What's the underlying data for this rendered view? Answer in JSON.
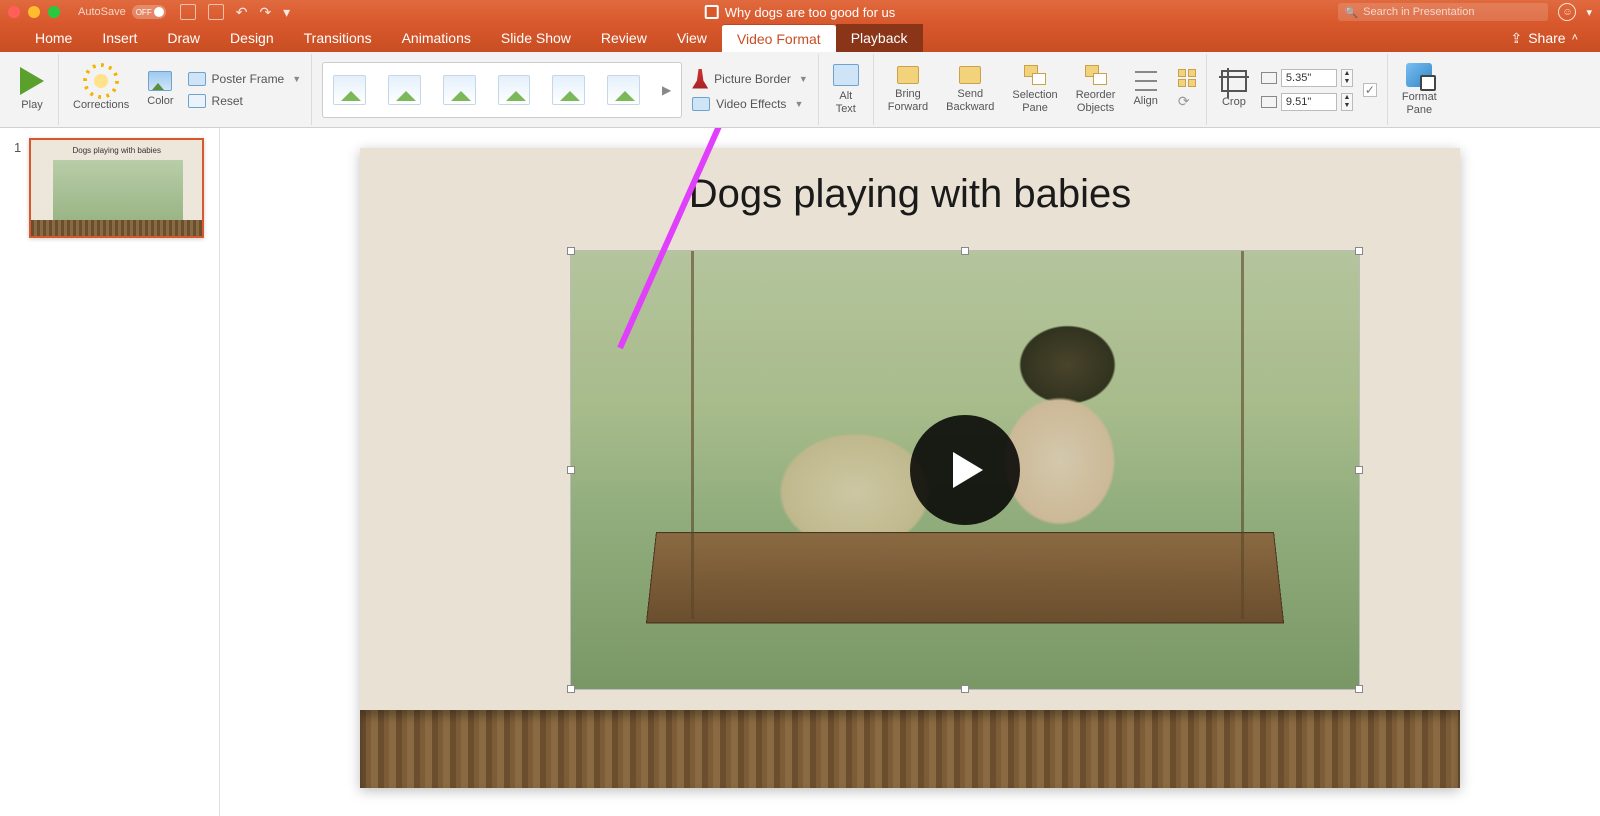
{
  "titlebar": {
    "autosave_label": "AutoSave",
    "autosave_state": "OFF",
    "doc_title": "Why dogs are too good for us",
    "search_placeholder": "Search in Presentation"
  },
  "tabs": {
    "items": [
      "Home",
      "Insert",
      "Draw",
      "Design",
      "Transitions",
      "Animations",
      "Slide Show",
      "Review",
      "View"
    ],
    "active": "Video Format",
    "context_extra": "Playback",
    "share": "Share"
  },
  "ribbon": {
    "play": "Play",
    "corrections": "Corrections",
    "color": "Color",
    "poster_frame": "Poster Frame",
    "reset": "Reset",
    "picture_border": "Picture Border",
    "video_effects": "Video Effects",
    "alt_text": "Alt\nText",
    "bring_forward": "Bring\nForward",
    "send_backward": "Send\nBackward",
    "selection_pane": "Selection\nPane",
    "reorder_objects": "Reorder\nObjects",
    "align": "Align",
    "crop": "Crop",
    "height_value": "5.35\"",
    "width_value": "9.51\"",
    "format_pane": "Format\nPane"
  },
  "thumbnails": {
    "items": [
      {
        "num": "1",
        "title": "Dogs playing with babies"
      }
    ]
  },
  "slide": {
    "title": "Dogs playing with babies"
  }
}
